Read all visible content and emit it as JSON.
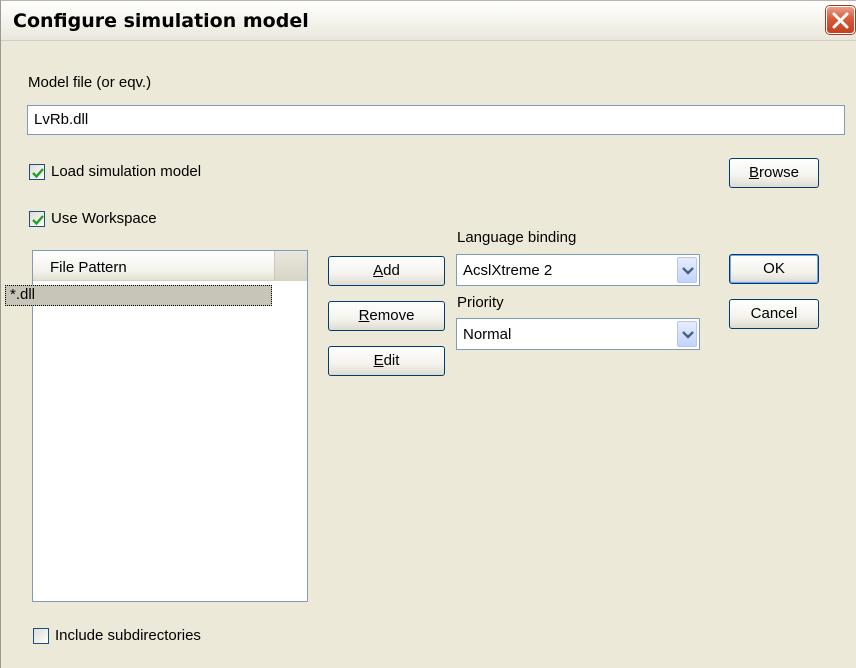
{
  "window": {
    "title": "Configure simulation model"
  },
  "model_file": {
    "label": "Model file (or eqv.)",
    "value": "LvRb.dll"
  },
  "load_model": {
    "label": "Load simulation model",
    "checked": true
  },
  "use_workspace": {
    "label": "Use Workspace",
    "checked": true
  },
  "browse_button": {
    "prefix": "",
    "accel": "B",
    "rest": "rowse"
  },
  "file_list": {
    "header": "File Pattern",
    "rows": [
      "*.dll"
    ]
  },
  "add_button": {
    "prefix": "",
    "accel": "A",
    "rest": "dd"
  },
  "remove_button": {
    "prefix": "",
    "accel": "R",
    "rest": "emove"
  },
  "edit_button": {
    "prefix": "",
    "accel": "E",
    "rest": "dit"
  },
  "language_binding": {
    "label": "Language binding",
    "value": "AcslXtreme 2"
  },
  "priority": {
    "label": "Priority",
    "value": "Normal"
  },
  "ok_button": {
    "label": "OK"
  },
  "cancel_button": {
    "label": "Cancel"
  },
  "include_subdirs": {
    "label": "Include subdirectories",
    "checked": false
  },
  "colors": {
    "accent": "#003c74",
    "field_border": "#7f9db9",
    "dialog_bg": "#ece9d8",
    "close": "#c1401f"
  },
  "icons": {
    "close": "close-icon",
    "check": "checkmark-icon",
    "dropdown": "chevron-down-icon"
  }
}
